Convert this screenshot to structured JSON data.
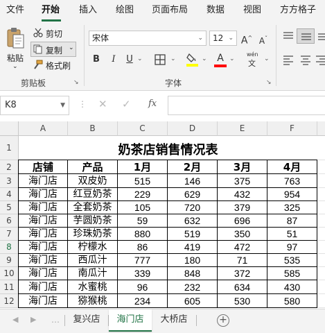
{
  "colors": {
    "accent": "#217346",
    "ribbon_bg": "#f3f3f3",
    "highlight_yellow": "#ffff00",
    "font_red": "#ff0000"
  },
  "menu": {
    "tabs": [
      {
        "label": "文件",
        "active": false
      },
      {
        "label": "开始",
        "active": true
      },
      {
        "label": "插入",
        "active": false
      },
      {
        "label": "绘图",
        "active": false
      },
      {
        "label": "页面布局",
        "active": false
      },
      {
        "label": "数据",
        "active": false
      },
      {
        "label": "视图",
        "active": false
      },
      {
        "label": "方方格子",
        "active": false
      }
    ]
  },
  "ribbon": {
    "clipboard": {
      "paste_label": "粘贴",
      "cut_label": "剪切",
      "copy_label": "复制",
      "format_painter_label": "格式刷",
      "group_label": "剪贴板"
    },
    "font": {
      "font_name": "宋体",
      "font_size": "12",
      "grow_label": "A",
      "shrink_label": "A",
      "bold_label": "B",
      "italic_label": "I",
      "underline_label": "U",
      "phonetic_label": "wén",
      "group_label": "字体"
    }
  },
  "formula_bar": {
    "name_box": "K8",
    "fx_label": "fx",
    "formula": ""
  },
  "sheet": {
    "columns": [
      "A",
      "B",
      "C",
      "D",
      "E",
      "F"
    ],
    "rows": [
      "1",
      "2",
      "3",
      "4",
      "5",
      "6",
      "7",
      "8",
      "9",
      "10",
      "11",
      "12"
    ],
    "selected_row": "8",
    "title": "奶茶店销售情况表",
    "headers": [
      "店铺",
      "产品",
      "1月",
      "2月",
      "3月",
      "4月"
    ],
    "data": [
      [
        "海门店",
        "双皮奶",
        "515",
        "146",
        "375",
        "763"
      ],
      [
        "海门店",
        "红豆奶茶",
        "229",
        "629",
        "432",
        "954"
      ],
      [
        "海门店",
        "全套奶茶",
        "105",
        "720",
        "379",
        "325"
      ],
      [
        "海门店",
        "芋圆奶茶",
        "59",
        "632",
        "696",
        "87"
      ],
      [
        "海门店",
        "珍珠奶茶",
        "880",
        "519",
        "350",
        "51"
      ],
      [
        "海门店",
        "柠檬水",
        "86",
        "419",
        "472",
        "97"
      ],
      [
        "海门店",
        "西瓜汁",
        "777",
        "180",
        "71",
        "535"
      ],
      [
        "海门店",
        "南瓜汁",
        "339",
        "848",
        "372",
        "585"
      ],
      [
        "海门店",
        "水蜜桃",
        "96",
        "232",
        "634",
        "430"
      ],
      [
        "海门店",
        "猕猴桃",
        "234",
        "605",
        "530",
        "580"
      ]
    ]
  },
  "sheet_tabs": {
    "tabs": [
      {
        "label": "复兴店",
        "active": false
      },
      {
        "label": "海门店",
        "active": true
      },
      {
        "label": "大桥店",
        "active": false
      }
    ],
    "add_label": "+"
  }
}
